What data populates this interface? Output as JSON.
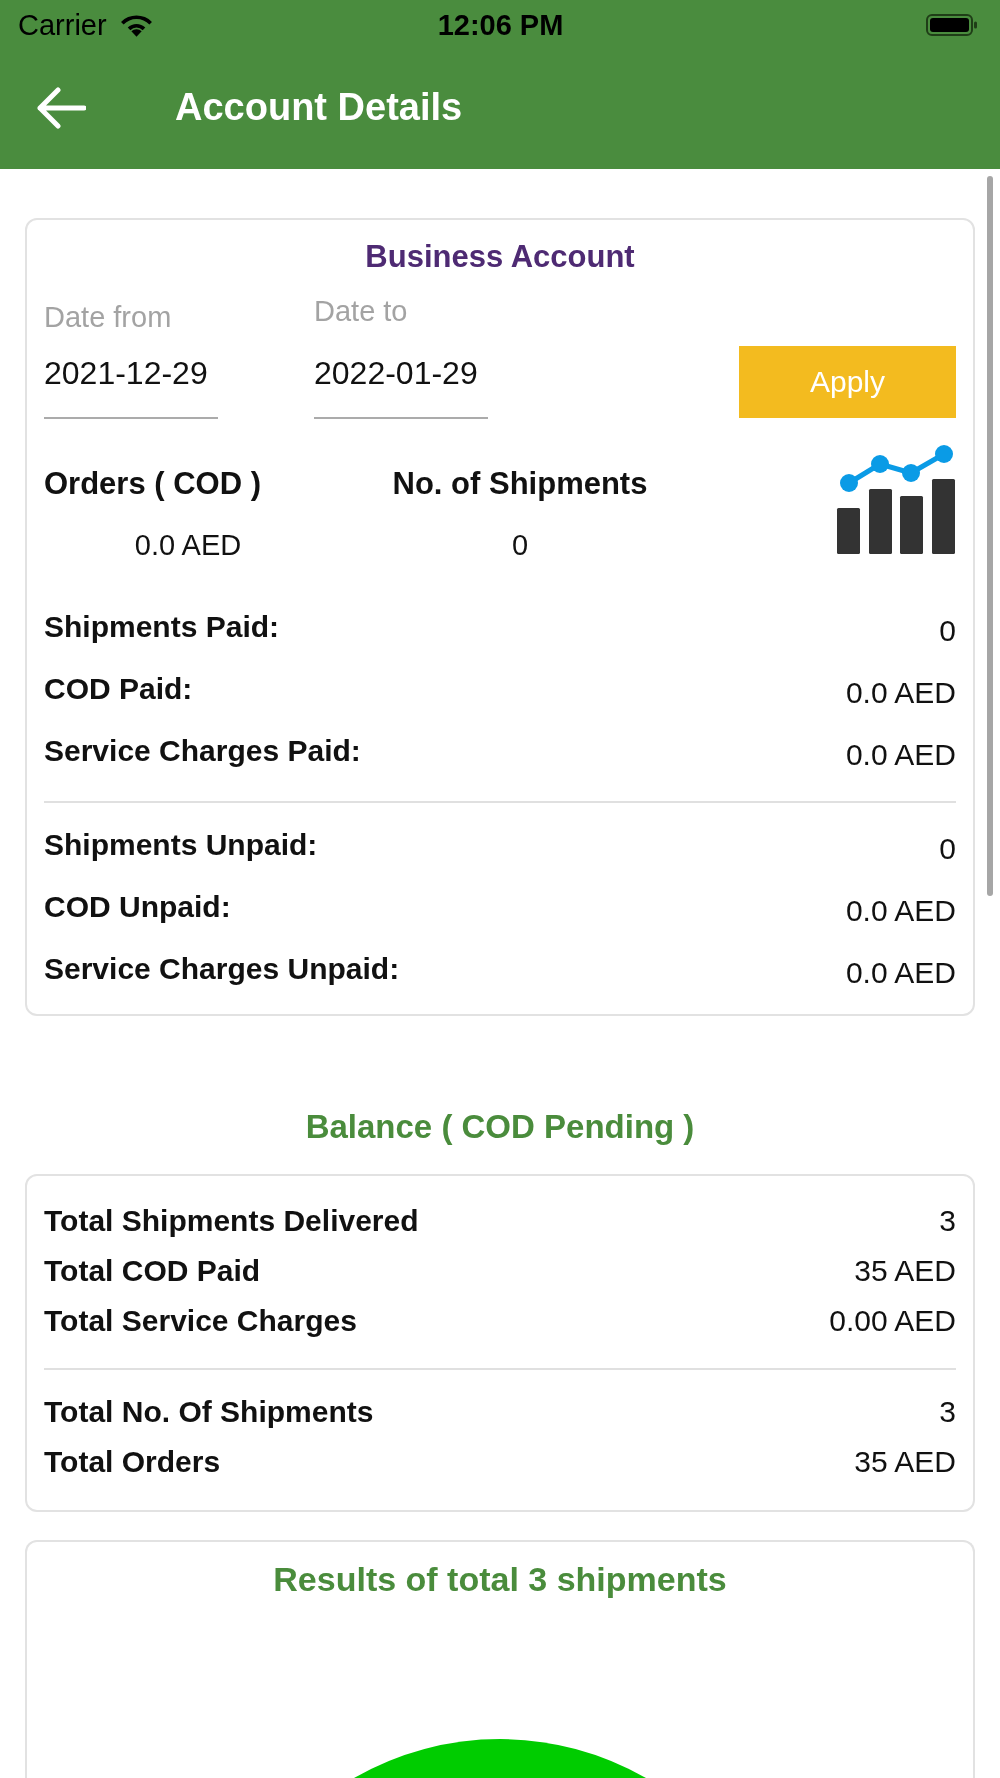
{
  "status_bar": {
    "carrier": "Carrier",
    "time": "12:06 PM"
  },
  "header": {
    "title": "Account Details"
  },
  "business_account": {
    "title": "Business Account",
    "date_from": {
      "label": "Date from",
      "value": "2021-12-29"
    },
    "date_to": {
      "label": "Date to",
      "value": "2022-01-29"
    },
    "apply_button": "Apply",
    "summary": [
      {
        "label": "Orders ( COD )",
        "value": "0.0 AED"
      },
      {
        "label": "No. of Shipments",
        "value": "0"
      }
    ],
    "sections": [
      {
        "rows": [
          {
            "label": "Shipments Paid:",
            "value": "0"
          },
          {
            "label": "COD Paid:",
            "value": "0.0 AED"
          },
          {
            "label": "Service Charges Paid:",
            "value": "0.0 AED"
          }
        ]
      },
      {
        "rows": [
          {
            "label": "Shipments Unpaid:",
            "value": "0"
          },
          {
            "label": "COD Unpaid:",
            "value": "0.0 AED"
          },
          {
            "label": "Service Charges Unpaid:",
            "value": "0.0 AED"
          }
        ]
      }
    ]
  },
  "balance": {
    "title": "Balance ( COD Pending )",
    "sections": [
      {
        "rows": [
          {
            "label": "Total Shipments Delivered",
            "value": "3"
          },
          {
            "label": "Total COD Paid",
            "value": "35 AED"
          },
          {
            "label": "Total Service Charges",
            "value": "0.00 AED"
          }
        ]
      },
      {
        "rows": [
          {
            "label": "Total No. Of Shipments",
            "value": "3"
          },
          {
            "label": "Total Orders",
            "value": "35 AED"
          }
        ]
      }
    ]
  },
  "results": {
    "title": "Results of total 3 shipments"
  }
}
